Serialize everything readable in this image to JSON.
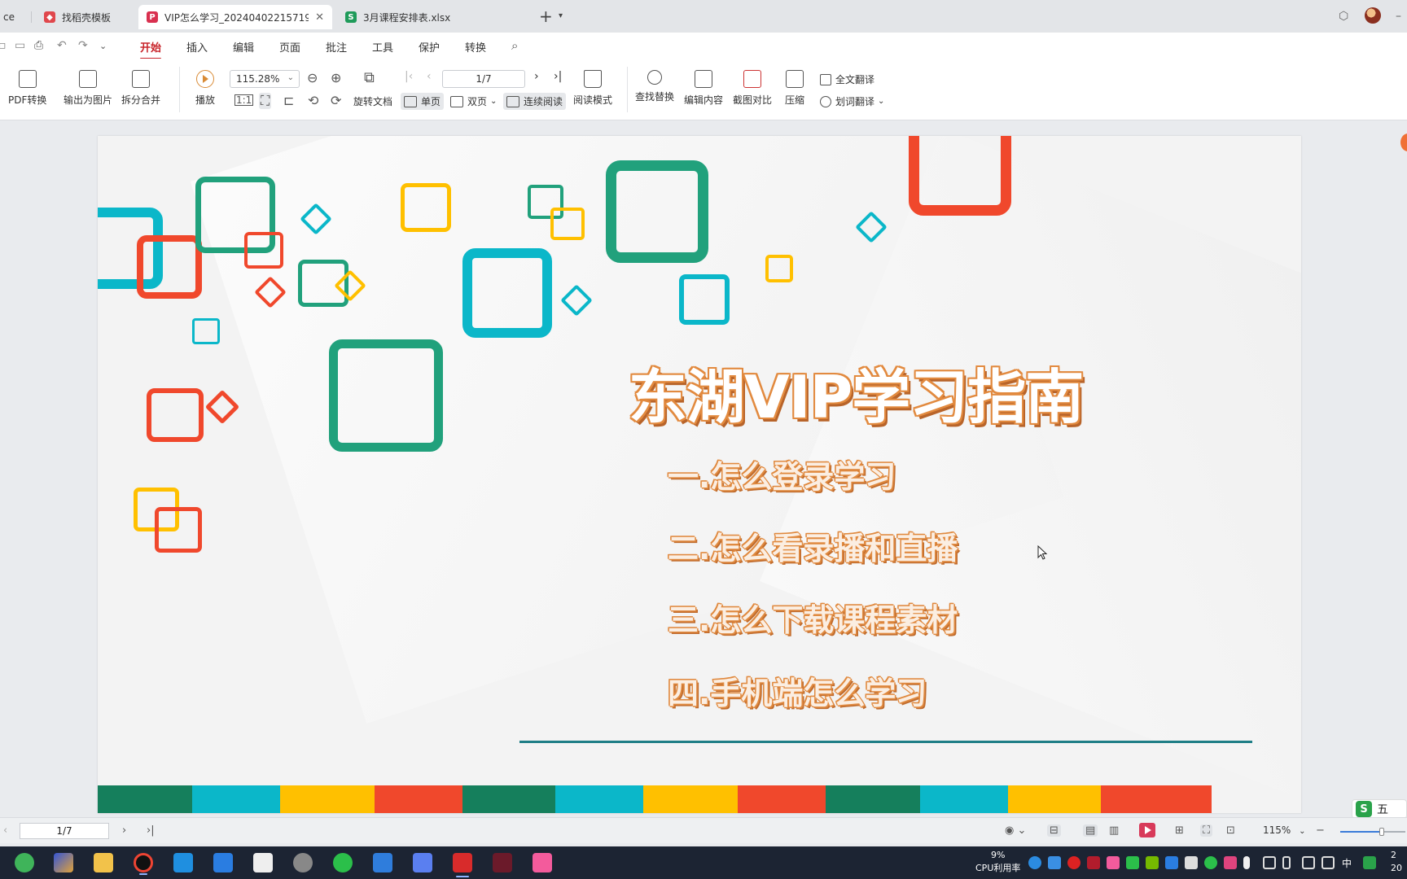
{
  "tabs": [
    {
      "label": "ce",
      "icon": "",
      "icon_color": ""
    },
    {
      "label": "找稻壳模板",
      "icon": "wps-docer-icon",
      "icon_color": "#e0474c"
    },
    {
      "label": "VIP怎么学习_20240402215719.p",
      "icon": "pdf-icon",
      "icon_color": "#d9304f",
      "active": true
    },
    {
      "label": "3月课程安排表.xlsx",
      "icon": "spreadsheet-icon",
      "icon_color": "#1f9b5a",
      "icon_letter": "S"
    }
  ],
  "menu": [
    "开始",
    "插入",
    "编辑",
    "页面",
    "批注",
    "工具",
    "保护",
    "转换"
  ],
  "ribbon": {
    "pdf_convert": "PDF转换",
    "export_image": "输出为图片",
    "split_merge": "拆分合并",
    "play": "播放",
    "zoom": "115.28%",
    "page": "1/7",
    "rotate": "旋转文档",
    "single_page": "单页",
    "double_page": "双页",
    "continuous": "连续阅读",
    "read_mode": "阅读模式",
    "find_replace": "查找替换",
    "edit_content": "编辑内容",
    "screenshot_compare": "截图对比",
    "compress": "压缩",
    "full_translate": "全文翻译",
    "word_translate": "划词翻译"
  },
  "slide": {
    "title": "东湖VIP学习指南",
    "items": [
      "一.怎么登录学习",
      "二.怎么看录播和直播",
      "三.怎么下载课程素材",
      "四.手机端怎么学习"
    ],
    "colors": {
      "green": "#21a17c",
      "cyan": "#0bb7c9",
      "yellow": "#ffc000",
      "red": "#f0482c",
      "dark_green": "#157f5c",
      "title_outline": "#e28a3f"
    },
    "strip_colors": [
      "#157f5c",
      "#0bb7c9",
      "#ffc000",
      "#f0482c",
      "#157f5c",
      "#0bb7c9",
      "#ffc000",
      "#f0482c",
      "#157f5c",
      "#0bb7c9",
      "#ffc000",
      "#f0482c"
    ]
  },
  "status": {
    "page": "1/7",
    "zoom": "115%"
  },
  "ime": {
    "label": "五"
  },
  "taskbar": {
    "cpu_value": "9%",
    "cpu_label": "CPU利用率",
    "lang": "中",
    "clock_line1": "2",
    "clock_line2": "20"
  }
}
